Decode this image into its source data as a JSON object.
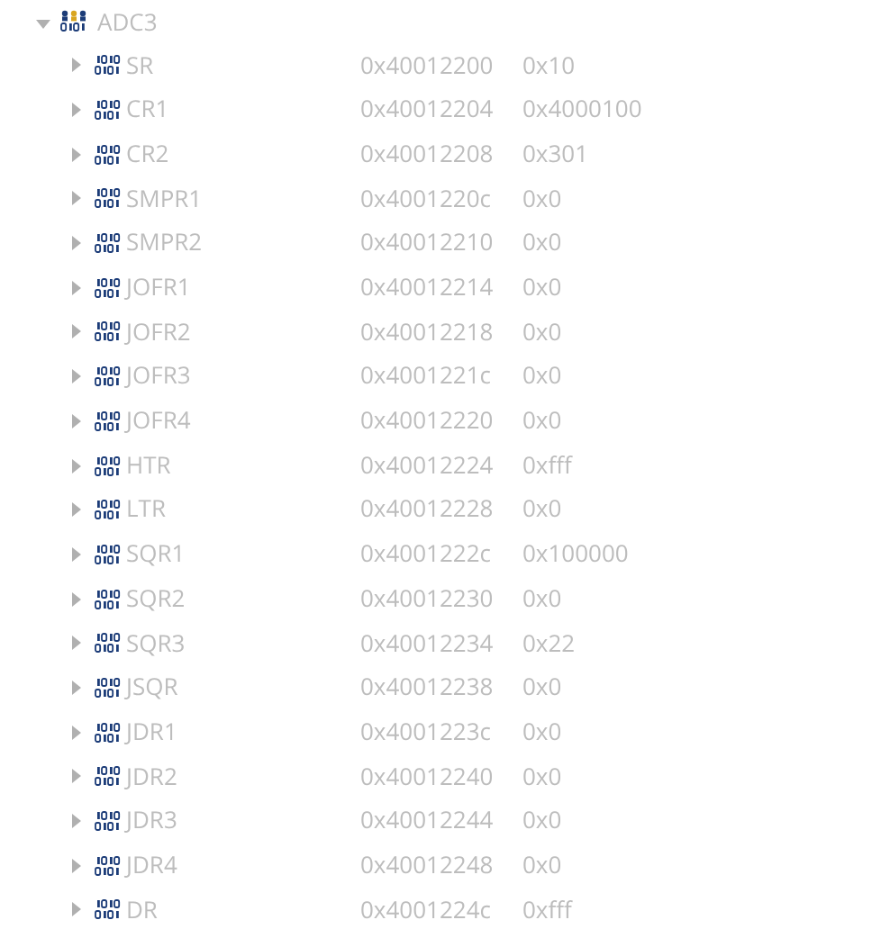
{
  "tree": {
    "name": "ADC3",
    "expanded": true,
    "children": [
      {
        "name": "SR",
        "address": "0x40012200",
        "value": "0x10",
        "expanded": false
      },
      {
        "name": "CR1",
        "address": "0x40012204",
        "value": "0x4000100",
        "expanded": false
      },
      {
        "name": "CR2",
        "address": "0x40012208",
        "value": "0x301",
        "expanded": false
      },
      {
        "name": "SMPR1",
        "address": "0x4001220c",
        "value": "0x0",
        "expanded": false
      },
      {
        "name": "SMPR2",
        "address": "0x40012210",
        "value": "0x0",
        "expanded": false
      },
      {
        "name": "JOFR1",
        "address": "0x40012214",
        "value": "0x0",
        "expanded": false
      },
      {
        "name": "JOFR2",
        "address": "0x40012218",
        "value": "0x0",
        "expanded": false
      },
      {
        "name": "JOFR3",
        "address": "0x4001221c",
        "value": "0x0",
        "expanded": false
      },
      {
        "name": "JOFR4",
        "address": "0x40012220",
        "value": "0x0",
        "expanded": false
      },
      {
        "name": "HTR",
        "address": "0x40012224",
        "value": "0xfff",
        "expanded": false
      },
      {
        "name": "LTR",
        "address": "0x40012228",
        "value": "0x0",
        "expanded": false
      },
      {
        "name": "SQR1",
        "address": "0x4001222c",
        "value": "0x100000",
        "expanded": false
      },
      {
        "name": "SQR2",
        "address": "0x40012230",
        "value": "0x0",
        "expanded": false
      },
      {
        "name": "SQR3",
        "address": "0x40012234",
        "value": "0x22",
        "expanded": false
      },
      {
        "name": "JSQR",
        "address": "0x40012238",
        "value": "0x0",
        "expanded": false
      },
      {
        "name": "JDR1",
        "address": "0x4001223c",
        "value": "0x0",
        "expanded": false
      },
      {
        "name": "JDR2",
        "address": "0x40012240",
        "value": "0x0",
        "expanded": false
      },
      {
        "name": "JDR3",
        "address": "0x40012244",
        "value": "0x0",
        "expanded": false
      },
      {
        "name": "JDR4",
        "address": "0x40012248",
        "value": "0x0",
        "expanded": false
      },
      {
        "name": "DR",
        "address": "0x4001224c",
        "value": "0xfff",
        "expanded": false
      }
    ]
  }
}
